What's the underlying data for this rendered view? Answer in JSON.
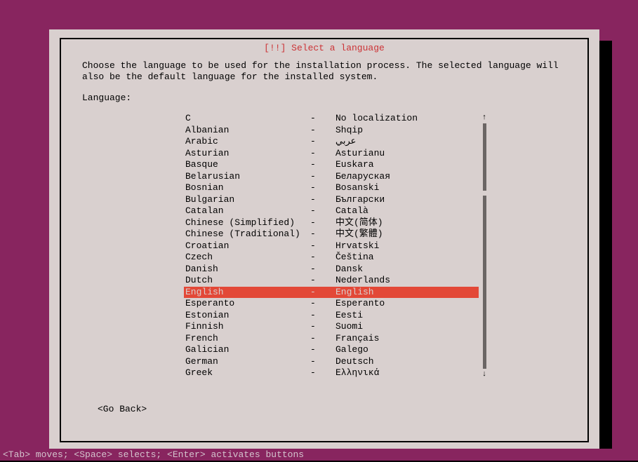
{
  "title": "[!!] Select a language",
  "instruction_line1": "Choose the language to be used for the installation process. The selected language will",
  "instruction_line2": "also be the default language for the installed system.",
  "label": "Language:",
  "separator": "-",
  "selected_index": 15,
  "languages": [
    {
      "name": "C",
      "native": "No localization"
    },
    {
      "name": "Albanian",
      "native": "Shqip"
    },
    {
      "name": "Arabic",
      "native": "عربي"
    },
    {
      "name": "Asturian",
      "native": "Asturianu"
    },
    {
      "name": "Basque",
      "native": "Euskara"
    },
    {
      "name": "Belarusian",
      "native": "Беларуская"
    },
    {
      "name": "Bosnian",
      "native": "Bosanski"
    },
    {
      "name": "Bulgarian",
      "native": "Български"
    },
    {
      "name": "Catalan",
      "native": "Català"
    },
    {
      "name": "Chinese (Simplified)",
      "native": "中文(简体)"
    },
    {
      "name": "Chinese (Traditional)",
      "native": "中文(繁體)"
    },
    {
      "name": "Croatian",
      "native": "Hrvatski"
    },
    {
      "name": "Czech",
      "native": "Čeština"
    },
    {
      "name": "Danish",
      "native": "Dansk"
    },
    {
      "name": "Dutch",
      "native": "Nederlands"
    },
    {
      "name": "English",
      "native": "English"
    },
    {
      "name": "Esperanto",
      "native": "Esperanto"
    },
    {
      "name": "Estonian",
      "native": "Eesti"
    },
    {
      "name": "Finnish",
      "native": "Suomi"
    },
    {
      "name": "French",
      "native": "Français"
    },
    {
      "name": "Galician",
      "native": "Galego"
    },
    {
      "name": "German",
      "native": "Deutsch"
    },
    {
      "name": "Greek",
      "native": "Ελληνικά"
    }
  ],
  "go_back": "<Go Back>",
  "help_bar": "<Tab> moves; <Space> selects; <Enter> activates buttons",
  "scroll_up": "↑",
  "scroll_down": "↓"
}
